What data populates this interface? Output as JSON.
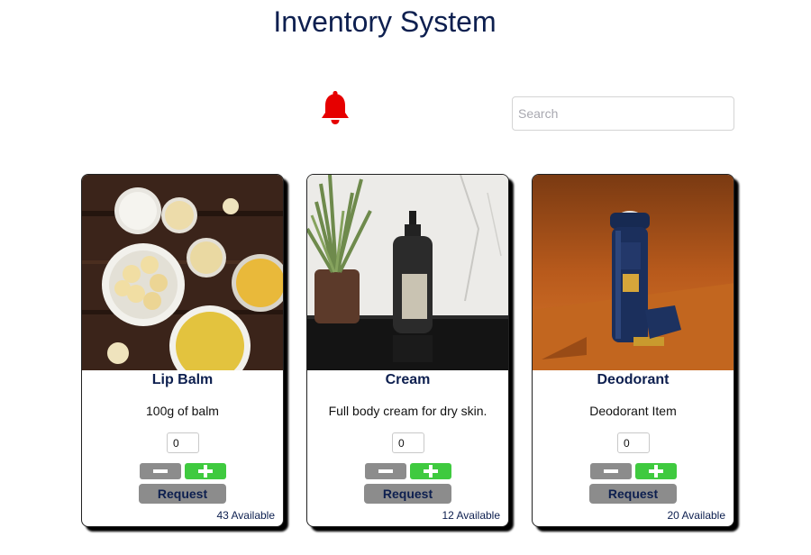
{
  "header": {
    "title": "Inventory System"
  },
  "notifications": {
    "icon": "bell-icon",
    "color": "#e60000"
  },
  "search": {
    "placeholder": "Search",
    "value": ""
  },
  "colors": {
    "text_navy": "#0d1f4f",
    "plus_green": "#3fca3f",
    "button_gray": "#8c8c8c"
  },
  "products": [
    {
      "name": "Lip Balm",
      "description": "100g of balm",
      "quantity": "0",
      "request_label": "Request",
      "available": "43 Available",
      "image": "lip-balm-photo"
    },
    {
      "name": "Cream",
      "description": "Full body cream for dry skin.",
      "quantity": "0",
      "request_label": "Request",
      "available": "12 Available",
      "image": "cream-bottle-photo"
    },
    {
      "name": "Deodorant",
      "description": "Deodorant Item",
      "quantity": "0",
      "request_label": "Request",
      "available": "20 Available",
      "image": "deodorant-photo"
    }
  ]
}
